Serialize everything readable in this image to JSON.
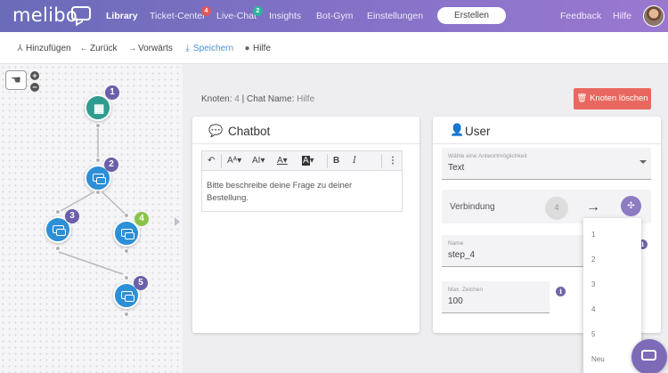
{
  "brand": {
    "name": "melibo"
  },
  "nav": {
    "items": [
      {
        "label": "Library",
        "active": true
      },
      {
        "label": "Ticket-Center",
        "badge": "4",
        "badge_color": "#e05757"
      },
      {
        "label": "Live-Chat",
        "badge": "2",
        "badge_color": "#2fb3a0"
      },
      {
        "label": "Insights"
      },
      {
        "label": "Bot-Gym"
      },
      {
        "label": "Einstellungen"
      }
    ],
    "create_label": "Erstellen",
    "feedback_label": "Feedback",
    "help_label": "Hilfe"
  },
  "toolbar": {
    "add": "Hinzufügen",
    "back": "Zurück",
    "forward": "Vorwärts",
    "save": "Speichern",
    "help": "Hilfe"
  },
  "graph": {
    "nodes": [
      {
        "number": "1",
        "type": "start"
      },
      {
        "number": "2",
        "type": "chatbot"
      },
      {
        "number": "3",
        "type": "chatbot"
      },
      {
        "number": "4",
        "type": "chatbot",
        "badge_color": "#8bc34a"
      },
      {
        "number": "5",
        "type": "chatbot"
      }
    ]
  },
  "node_info": {
    "knoten_label": "Knoten:",
    "knoten_value": "4",
    "chatname_label": "Chat Name:",
    "chatname_value": "Hilfe",
    "delete_label": "Knoten löschen"
  },
  "chatbot_card": {
    "title": "Chatbot",
    "editor_text": "Bitte beschreibe deine Frage zu deiner Bestellung."
  },
  "user_card": {
    "title": "User",
    "answer_label": "Wähle eine Antwortmöglichkeit",
    "answer_value": "Text",
    "connection_label": "Verbindung",
    "connection_from": "4",
    "name_label": "Name",
    "name_value": "step_4",
    "max_label": "Max. Zeichen",
    "max_value": "100"
  },
  "dropdown": {
    "options": [
      "1",
      "2",
      "3",
      "4",
      "5",
      "Neu"
    ]
  },
  "colors": {
    "nav_gradient_start": "#6a6bb8",
    "nav_gradient_end": "#9a78d0",
    "delete_red": "#e8685f",
    "node_blue": "#2d8fd6",
    "node_teal": "#2f9c8f",
    "badge_purple": "#6b5fa8",
    "accent_purple": "#8e7cc3"
  }
}
